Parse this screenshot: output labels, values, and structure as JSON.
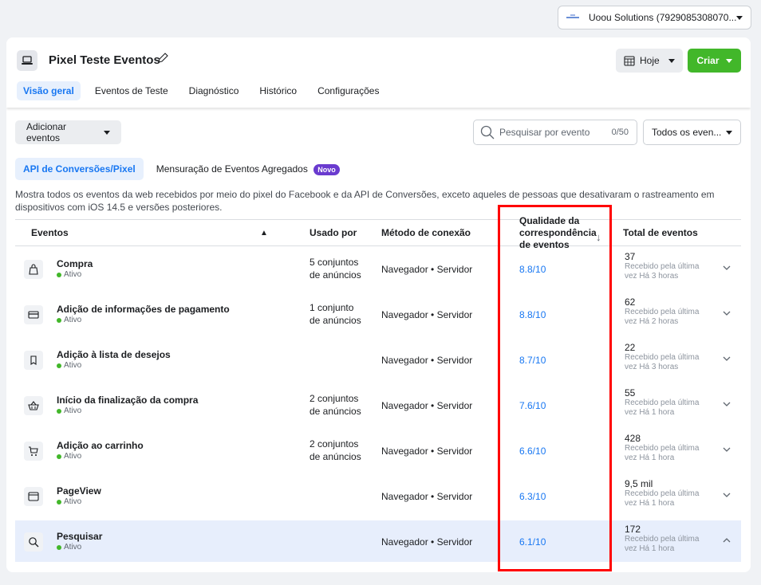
{
  "account": {
    "name": "Uoou Solutions (7929085308070..."
  },
  "pixel": {
    "title": "Pixel Teste Eventos"
  },
  "toolbar": {
    "date_label": "Hoje",
    "create_label": "Criar"
  },
  "tabs": [
    {
      "label": "Visão geral",
      "active": true
    },
    {
      "label": "Eventos de Teste"
    },
    {
      "label": "Diagnóstico"
    },
    {
      "label": "Histórico"
    },
    {
      "label": "Configurações"
    }
  ],
  "actions": {
    "add_events_label": "Adicionar eventos",
    "search_placeholder": "Pesquisar por evento",
    "search_count": "0/50",
    "filter_label": "Todos os even..."
  },
  "subtabs": [
    {
      "label": "API de Conversões/Pixel",
      "active": true
    },
    {
      "label": "Mensuração de Eventos Agregados",
      "badge": "Novo"
    }
  ],
  "description": "Mostra todos os eventos da web recebidos por meio do pixel do Facebook e da API de Conversões, exceto aqueles de pessoas que desativaram o rastreamento em dispositivos com iOS 14.5 e versões posteriores.",
  "table": {
    "headers": {
      "events": "Eventos",
      "warning": "▲",
      "used_by": "Usado por",
      "method": "Método de conexão",
      "quality_line1": "Qualidade da",
      "quality_line2": "correspondência",
      "quality_line3": "de eventos",
      "quality_sort": "↓",
      "total": "Total de eventos"
    },
    "rows": [
      {
        "icon": "shopping-bag-icon",
        "name": "Compra",
        "status": "Ativo",
        "used_line1": "5 conjuntos",
        "used_line2": "de anúncios",
        "method": "Navegador • Servidor",
        "quality": "8.8/10",
        "total": "37",
        "received_line1": "Recebido pela última",
        "received_line2": "vez Há 3 horas",
        "expanded": false
      },
      {
        "icon": "credit-card-icon",
        "name": "Adição de informações de pagamento",
        "status": "Ativo",
        "used_line1": "1 conjunto",
        "used_line2": "de anúncios",
        "method": "Navegador • Servidor",
        "quality": "8.8/10",
        "total": "62",
        "received_line1": "Recebido pela última",
        "received_line2": "vez Há 2 horas",
        "expanded": false
      },
      {
        "icon": "bookmark-icon",
        "name": "Adição à lista de desejos",
        "status": "Ativo",
        "used_line1": "",
        "used_line2": "",
        "method": "Navegador • Servidor",
        "quality": "8.7/10",
        "total": "22",
        "received_line1": "Recebido pela última",
        "received_line2": "vez Há 3 horas",
        "expanded": false
      },
      {
        "icon": "basket-icon",
        "name": "Início da finalização da compra",
        "status": "Ativo",
        "used_line1": "2 conjuntos",
        "used_line2": "de anúncios",
        "method": "Navegador • Servidor",
        "quality": "7.6/10",
        "total": "55",
        "received_line1": "Recebido pela última",
        "received_line2": "vez Há 1 hora",
        "expanded": false
      },
      {
        "icon": "cart-icon",
        "name": "Adição ao carrinho",
        "status": "Ativo",
        "used_line1": "2 conjuntos",
        "used_line2": "de anúncios",
        "method": "Navegador • Servidor",
        "quality": "6.6/10",
        "total": "428",
        "received_line1": "Recebido pela última",
        "received_line2": "vez Há 1 hora",
        "expanded": false
      },
      {
        "icon": "browser-window-icon",
        "name": "PageView",
        "status": "Ativo",
        "used_line1": "",
        "used_line2": "",
        "method": "Navegador • Servidor",
        "quality": "6.3/10",
        "total": "9,5 mil",
        "received_line1": "Recebido pela última",
        "received_line2": "vez Há 1 hora",
        "expanded": false
      },
      {
        "icon": "search-icon",
        "name": "Pesquisar",
        "status": "Ativo",
        "used_line1": "",
        "used_line2": "",
        "method": "Navegador • Servidor",
        "quality": "6.1/10",
        "total": "172",
        "received_line1": "Recebido pela última",
        "received_line2": "vez Há 1 hora",
        "expanded": true
      }
    ]
  },
  "colors": {
    "accent": "#1877f2",
    "create": "#42b72a",
    "badge": "#6a3bcf",
    "highlight_box": "#ff0000",
    "selected_row": "#e7eefc"
  }
}
